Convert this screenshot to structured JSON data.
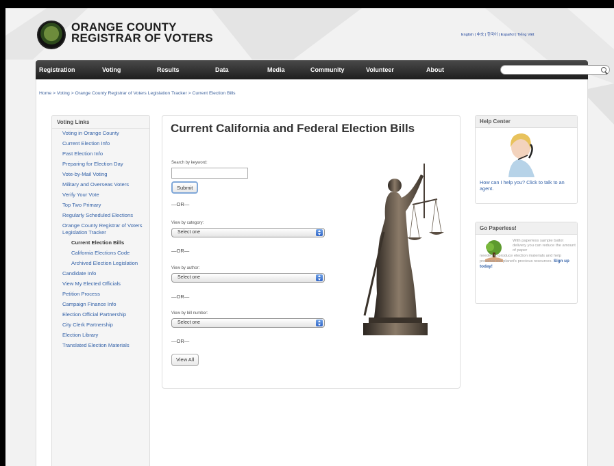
{
  "header": {
    "logo_line1": "ORANGE COUNTY",
    "logo_line2": "REGISTRAR OF VOTERS",
    "lang_links": "English | 中文 | 한국어 | Español | Tiếng Việt"
  },
  "nav": {
    "items": [
      "Registration",
      "Voting",
      "Results",
      "Data",
      "Media",
      "Community",
      "Volunteer",
      "About"
    ],
    "search_value": ""
  },
  "breadcrumb": "Home > Voting > Orange County Registrar of Voters Legislation Tracker > Current Election Bills",
  "sidebar": {
    "title": "Voting Links",
    "items": [
      "Voting in Orange County",
      "Current Election Info",
      "Past Election Info",
      "Preparing for Election Day",
      "Vote-by-Mail Voting",
      "Military and Overseas Voters",
      "Verify Your Vote",
      "Top Two Primary",
      "Regularly Scheduled Elections",
      "Orange County Registrar of Voters Legislation Tracker",
      "Current Election Bills",
      "California Elections Code",
      "Archived Election Legislation",
      "Candidate Info",
      "View My Elected Officials",
      "Petition Process",
      "Campaign Finance Info",
      "Election Official Partnership",
      "City Clerk Partnership",
      "Election Library",
      "Translated Election Materials"
    ]
  },
  "main": {
    "title": "Current California and Federal Election Bills",
    "keyword_label": "Search by keyword:",
    "keyword_value": "",
    "submit_label": "Submit",
    "or_text": "—OR—",
    "category_label": "View by category:",
    "category_value": "Select one",
    "author_label": "View by author:",
    "author_value": "Select one",
    "bill_label": "View by bill number:",
    "bill_value": "Select one",
    "view_all_label": "View All"
  },
  "help_center": {
    "title": "Help Center",
    "text": "How can I help you? Click to talk to an agent."
  },
  "paperless": {
    "title": "Go Paperless!",
    "text_a": "With paperless sample ballot delivery you can reduce the amount of paper",
    "text_b": "needed to produce election materials and help preserve our planet's precious resources.",
    "signup": "Sign up today!"
  },
  "colors": {
    "nav_bg": "#2a2a2a",
    "link_blue": "#3462a8",
    "select_arrow": "#3a6fcf"
  }
}
